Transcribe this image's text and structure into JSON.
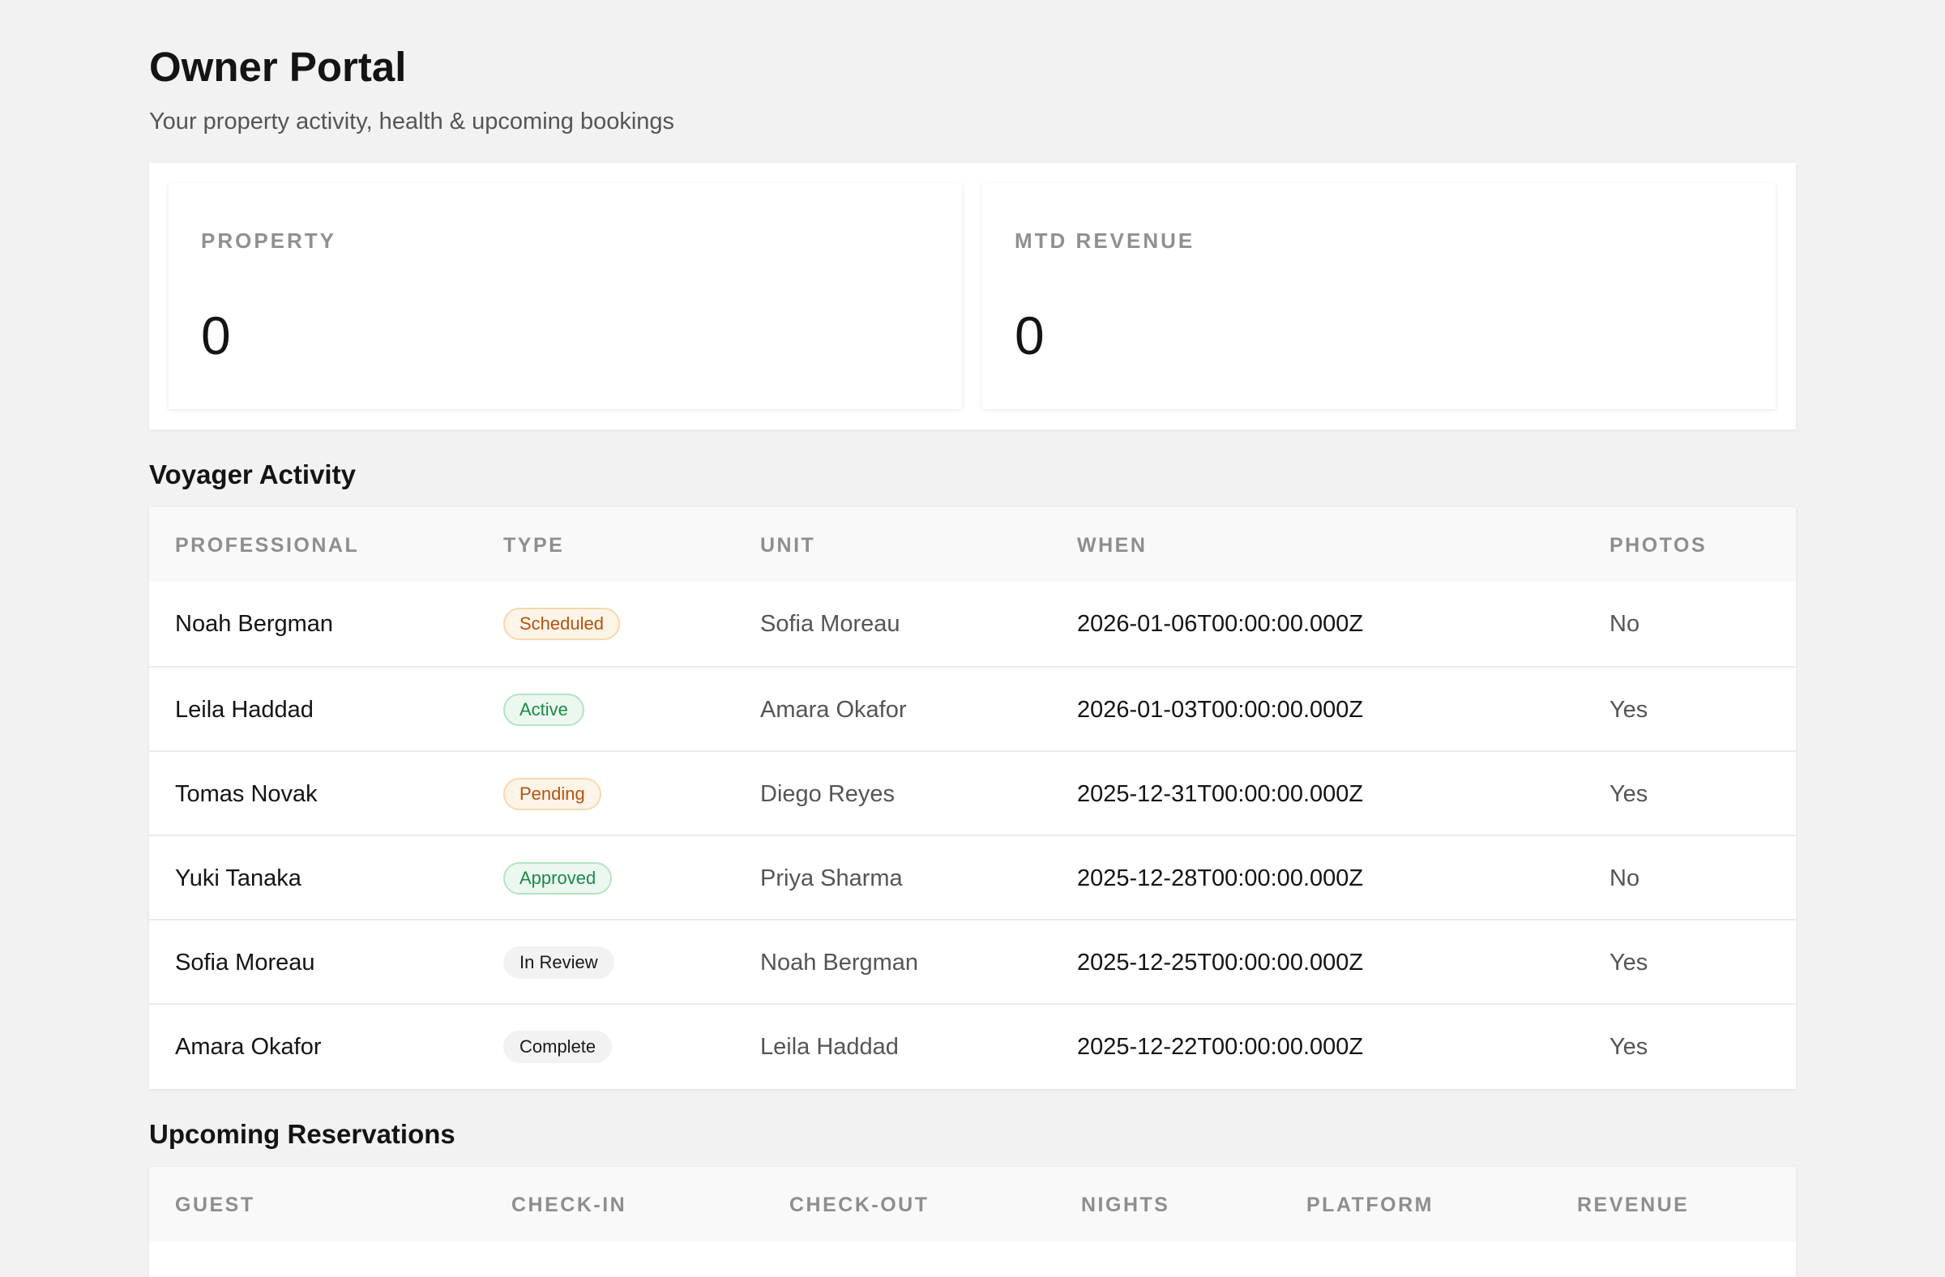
{
  "page": {
    "title": "Owner Portal",
    "subtitle": "Your property activity, health & upcoming bookings"
  },
  "stats": [
    {
      "label": "PROPERTY",
      "value": "0"
    },
    {
      "label": "MTD REVENUE",
      "value": "0"
    }
  ],
  "activity": {
    "title": "Voyager Activity",
    "columns": [
      "PROFESSIONAL",
      "TYPE",
      "UNIT",
      "WHEN",
      "PHOTOS"
    ],
    "rows": [
      {
        "professional": "Noah Bergman",
        "type": "Scheduled",
        "type_tone": "warning",
        "unit": "Sofia Moreau",
        "when": "2026-01-06T00:00:00.000Z",
        "photos": "No"
      },
      {
        "professional": "Leila Haddad",
        "type": "Active",
        "type_tone": "success",
        "unit": "Amara Okafor",
        "when": "2026-01-03T00:00:00.000Z",
        "photos": "Yes"
      },
      {
        "professional": "Tomas Novak",
        "type": "Pending",
        "type_tone": "warning",
        "unit": "Diego Reyes",
        "when": "2025-12-31T00:00:00.000Z",
        "photos": "Yes"
      },
      {
        "professional": "Yuki Tanaka",
        "type": "Approved",
        "type_tone": "success",
        "unit": "Priya Sharma",
        "when": "2025-12-28T00:00:00.000Z",
        "photos": "No"
      },
      {
        "professional": "Sofia Moreau",
        "type": "In Review",
        "type_tone": "neutral",
        "unit": "Noah Bergman",
        "when": "2025-12-25T00:00:00.000Z",
        "photos": "Yes"
      },
      {
        "professional": "Amara Okafor",
        "type": "Complete",
        "type_tone": "neutral",
        "unit": "Leila Haddad",
        "when": "2025-12-22T00:00:00.000Z",
        "photos": "Yes"
      }
    ]
  },
  "reservations": {
    "title": "Upcoming Reservations",
    "columns": [
      "GUEST",
      "CHECK-IN",
      "CHECK-OUT",
      "NIGHTS",
      "PLATFORM",
      "REVENUE"
    ]
  },
  "colors": {
    "background": "#f2f2f2",
    "card": "#ffffff",
    "warning": "#b4530e",
    "success": "#1c8a45"
  }
}
